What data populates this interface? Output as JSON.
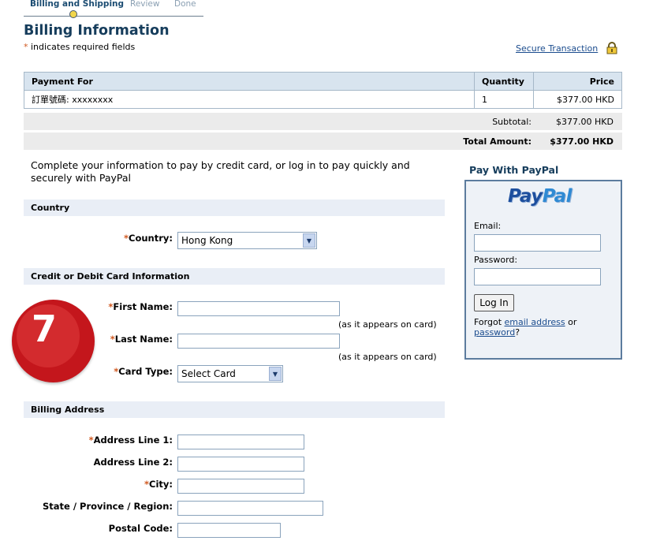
{
  "steps": {
    "billing": "Billing and Shipping",
    "review": "Review",
    "done": "Done"
  },
  "page_title": "Billing Information",
  "required_note": "indicates required fields",
  "secure_link": "Secure Transaction",
  "table": {
    "headers": [
      "Payment For",
      "Quantity",
      "Price"
    ],
    "rows": [
      {
        "item": "訂單號碼: xxxxxxxx",
        "qty": "1",
        "price": "$377.00 HKD"
      }
    ],
    "subtotal_label": "Subtotal:",
    "subtotal_value": "$377.00 HKD",
    "total_label": "Total Amount:",
    "total_value": "$377.00 HKD"
  },
  "intro": "Complete your information to pay by credit card, or log in to pay quickly and securely with PayPal",
  "country_section": {
    "title": "Country",
    "label": "Country:",
    "value": "Hong Kong"
  },
  "card_section": {
    "title": "Credit or Debit Card Information",
    "first_name": "First Name:",
    "last_name": "Last Name:",
    "hint": "(as it appears on card)",
    "card_type": "Card Type:",
    "card_type_value": "Select Card"
  },
  "billing_section": {
    "title": "Billing Address",
    "address1": "Address Line 1:",
    "address2": "Address Line 2:",
    "city": "City:",
    "state": "State / Province / Region:",
    "postal": "Postal Code:"
  },
  "paypal": {
    "title": "Pay With PayPal",
    "logo_pay": "Pay",
    "logo_pal": "Pal",
    "email": "Email:",
    "password": "Password:",
    "login": "Log In",
    "forgot_prefix": "Forgot",
    "forgot_email": "email address",
    "forgot_or": "or",
    "forgot_password": "password",
    "forgot_suffix": "?"
  },
  "badge_number": "7",
  "colors": {
    "heading": "#163d5c",
    "required": "#d0581f",
    "link": "#1b4c8e",
    "badge": "#c4161c"
  }
}
